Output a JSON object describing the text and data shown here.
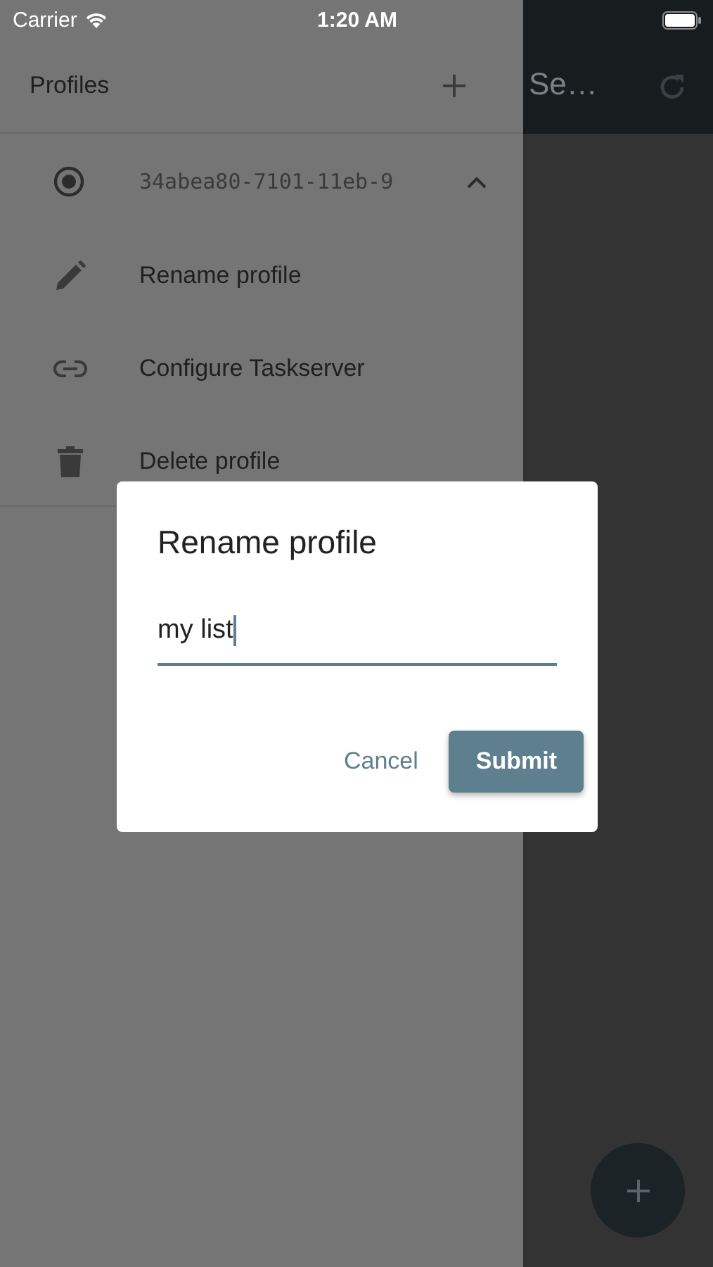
{
  "status_bar": {
    "carrier": "Carrier",
    "time": "1:20 AM"
  },
  "app_bar": {
    "title": "Se…"
  },
  "drawer": {
    "title": "Profiles",
    "profiles": [
      {
        "name": "34abea80-7101-11eb-9",
        "selected": true,
        "expanded": true,
        "actions": [
          {
            "kind": "rename",
            "label": "Rename profile"
          },
          {
            "kind": "link",
            "label": "Configure Taskserver"
          },
          {
            "kind": "delete",
            "label": "Delete profile"
          }
        ]
      }
    ]
  },
  "dialog": {
    "title": "Rename profile",
    "value": "my list",
    "buttons": [
      {
        "kind": "text",
        "label": "Cancel"
      },
      {
        "kind": "filled",
        "label": "Submit"
      }
    ]
  }
}
